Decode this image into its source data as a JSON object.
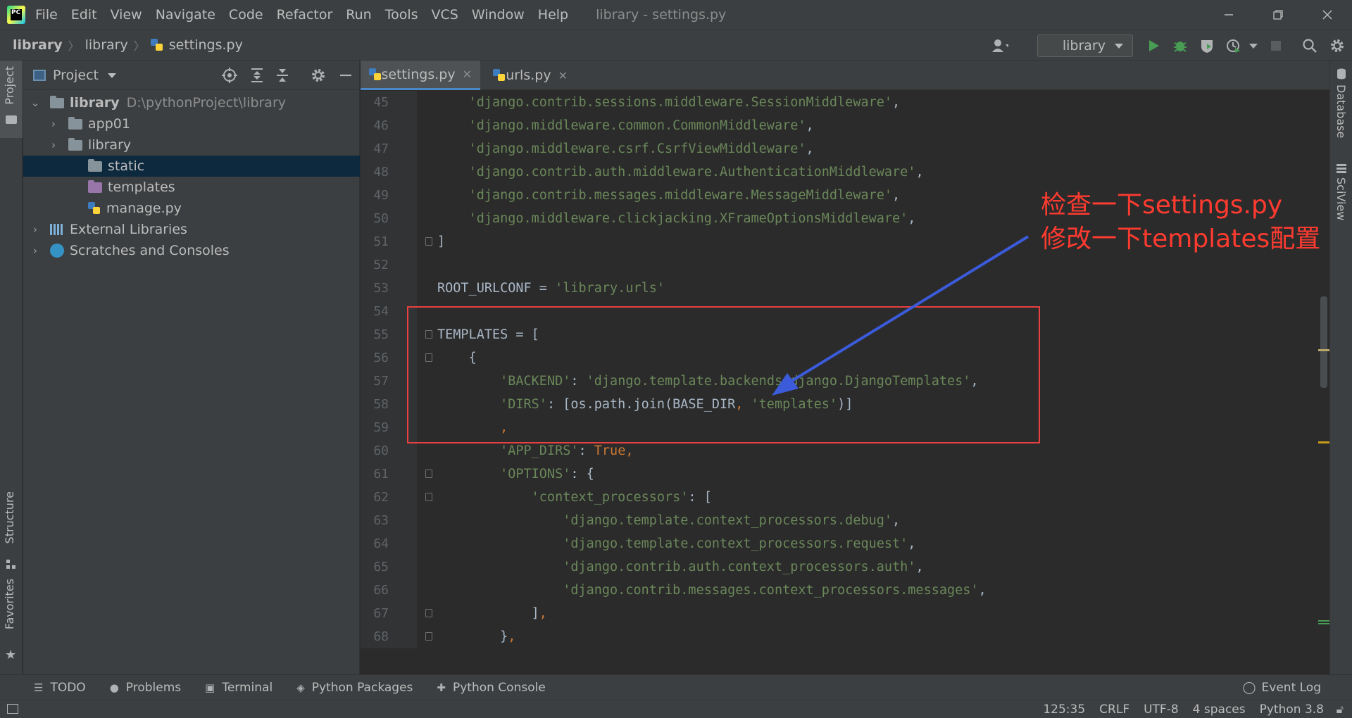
{
  "menubar": {
    "items": [
      "File",
      "Edit",
      "View",
      "Navigate",
      "Code",
      "Refactor",
      "Run",
      "Tools",
      "VCS",
      "Window",
      "Help"
    ],
    "window_title": "library - settings.py"
  },
  "navbar": {
    "breadcrumbs": [
      "library",
      "library",
      "settings.py"
    ],
    "run_config": "library"
  },
  "left_strip": {
    "project_tab": "Project",
    "structure_tab": "Structure",
    "favorites_tab": "Favorites"
  },
  "right_strip": {
    "database_tab": "Database",
    "sciview_tab": "SciView"
  },
  "project_panel": {
    "title": "Project",
    "root_name": "library",
    "root_path": "D:\\pythonProject\\library",
    "items": [
      {
        "label": "app01"
      },
      {
        "label": "library"
      },
      {
        "label": "static"
      },
      {
        "label": "templates"
      },
      {
        "label": "manage.py"
      }
    ],
    "external_libraries": "External Libraries",
    "scratches": "Scratches and Consoles"
  },
  "editor": {
    "tabs": [
      {
        "label": "settings.py"
      },
      {
        "label": "urls.py"
      }
    ],
    "inspection": {
      "errors": "1",
      "warnings": "2",
      "ok": "1"
    },
    "lines": [
      {
        "n": "45",
        "tokens": [
          [
            "    ",
            ""
          ],
          [
            "'django.contrib.sessions.middleware.SessionMiddleware'",
            "s"
          ],
          [
            ",",
            ""
          ]
        ]
      },
      {
        "n": "46",
        "tokens": [
          [
            "    ",
            ""
          ],
          [
            "'django.middleware.common.CommonMiddleware'",
            "s"
          ],
          [
            ",",
            ""
          ]
        ]
      },
      {
        "n": "47",
        "tokens": [
          [
            "    ",
            ""
          ],
          [
            "'django.middleware.csrf.CsrfViewMiddleware'",
            "s"
          ],
          [
            ",",
            ""
          ]
        ]
      },
      {
        "n": "48",
        "tokens": [
          [
            "    ",
            ""
          ],
          [
            "'django.contrib.auth.middleware.AuthenticationMiddleware'",
            "s"
          ],
          [
            ",",
            ""
          ]
        ]
      },
      {
        "n": "49",
        "tokens": [
          [
            "    ",
            ""
          ],
          [
            "'django.contrib.messages.middleware.MessageMiddleware'",
            "s"
          ],
          [
            ",",
            ""
          ]
        ]
      },
      {
        "n": "50",
        "tokens": [
          [
            "    ",
            ""
          ],
          [
            "'django.middleware.clickjacking.XFrameOptionsMiddleware'",
            "s"
          ],
          [
            ",",
            ""
          ]
        ]
      },
      {
        "n": "51",
        "tokens": [
          [
            "]",
            ""
          ]
        ]
      },
      {
        "n": "52",
        "tokens": []
      },
      {
        "n": "53",
        "tokens": [
          [
            "ROOT_URLCONF = ",
            ""
          ],
          [
            "'library.urls'",
            "s"
          ]
        ]
      },
      {
        "n": "54",
        "tokens": []
      },
      {
        "n": "55",
        "tokens": [
          [
            "TEMPLATES = [",
            ""
          ]
        ]
      },
      {
        "n": "56",
        "tokens": [
          [
            "    {",
            ""
          ]
        ]
      },
      {
        "n": "57",
        "tokens": [
          [
            "        ",
            ""
          ],
          [
            "'BACKEND'",
            "s"
          ],
          [
            ": ",
            ""
          ],
          [
            "'django.template.backends.django.DjangoTemplates'",
            "s"
          ],
          [
            ",",
            ""
          ]
        ]
      },
      {
        "n": "58",
        "tokens": [
          [
            "        ",
            ""
          ],
          [
            "'DIRS'",
            "s"
          ],
          [
            ": [os.path.join(BASE_DIR",
            ""
          ],
          [
            ", ",
            "kw"
          ],
          [
            "'templates'",
            "s"
          ],
          [
            ")]",
            ""
          ]
        ]
      },
      {
        "n": "59",
        "tokens": [
          [
            "        ",
            ""
          ],
          [
            ",",
            "kw"
          ]
        ]
      },
      {
        "n": "60",
        "tokens": [
          [
            "        ",
            ""
          ],
          [
            "'APP_DIRS'",
            "s"
          ],
          [
            ": ",
            ""
          ],
          [
            "True",
            "kw"
          ],
          [
            ",",
            "kw"
          ]
        ]
      },
      {
        "n": "61",
        "tokens": [
          [
            "        ",
            ""
          ],
          [
            "'OPTIONS'",
            "s"
          ],
          [
            ": {",
            ""
          ]
        ]
      },
      {
        "n": "62",
        "tokens": [
          [
            "            ",
            ""
          ],
          [
            "'context_processors'",
            "s"
          ],
          [
            ": [",
            ""
          ]
        ]
      },
      {
        "n": "63",
        "tokens": [
          [
            "                ",
            ""
          ],
          [
            "'django.template.context_processors.debug'",
            "s"
          ],
          [
            ",",
            ""
          ]
        ]
      },
      {
        "n": "64",
        "tokens": [
          [
            "                ",
            ""
          ],
          [
            "'django.template.context_processors.request'",
            "s"
          ],
          [
            ",",
            ""
          ]
        ]
      },
      {
        "n": "65",
        "tokens": [
          [
            "                ",
            ""
          ],
          [
            "'django.contrib.auth.context_processors.auth'",
            "s"
          ],
          [
            ",",
            ""
          ]
        ]
      },
      {
        "n": "66",
        "tokens": [
          [
            "                ",
            ""
          ],
          [
            "'django.contrib.messages.context_processors.messages'",
            "s"
          ],
          [
            ",",
            ""
          ]
        ]
      },
      {
        "n": "67",
        "tokens": [
          [
            "            ",
            ""
          ],
          [
            "]",
            ""
          ],
          [
            ",",
            "kw"
          ]
        ]
      },
      {
        "n": "68",
        "tokens": [
          [
            "        ",
            ""
          ],
          [
            "}",
            ""
          ],
          [
            ",",
            "kw"
          ]
        ]
      }
    ]
  },
  "annotation": {
    "line1": "检查一下settings.py",
    "line2": "修改一下templates配置",
    "color": "#ff3b30"
  },
  "bottom_tools": [
    "TODO",
    "Problems",
    "Terminal",
    "Python Packages",
    "Python Console"
  ],
  "event_log": "Event Log",
  "statusbar": {
    "position": "125:35",
    "line_sep": "CRLF",
    "encoding": "UTF-8",
    "indent": "4 spaces",
    "interpreter": "Python 3.8"
  },
  "colors": {
    "string": "#6a8759",
    "keyword": "#cc7832",
    "text": "#a9b7c6",
    "selection": "#0d293e",
    "annotation_box": "#e84040",
    "arrow": "#3b5bdb"
  }
}
